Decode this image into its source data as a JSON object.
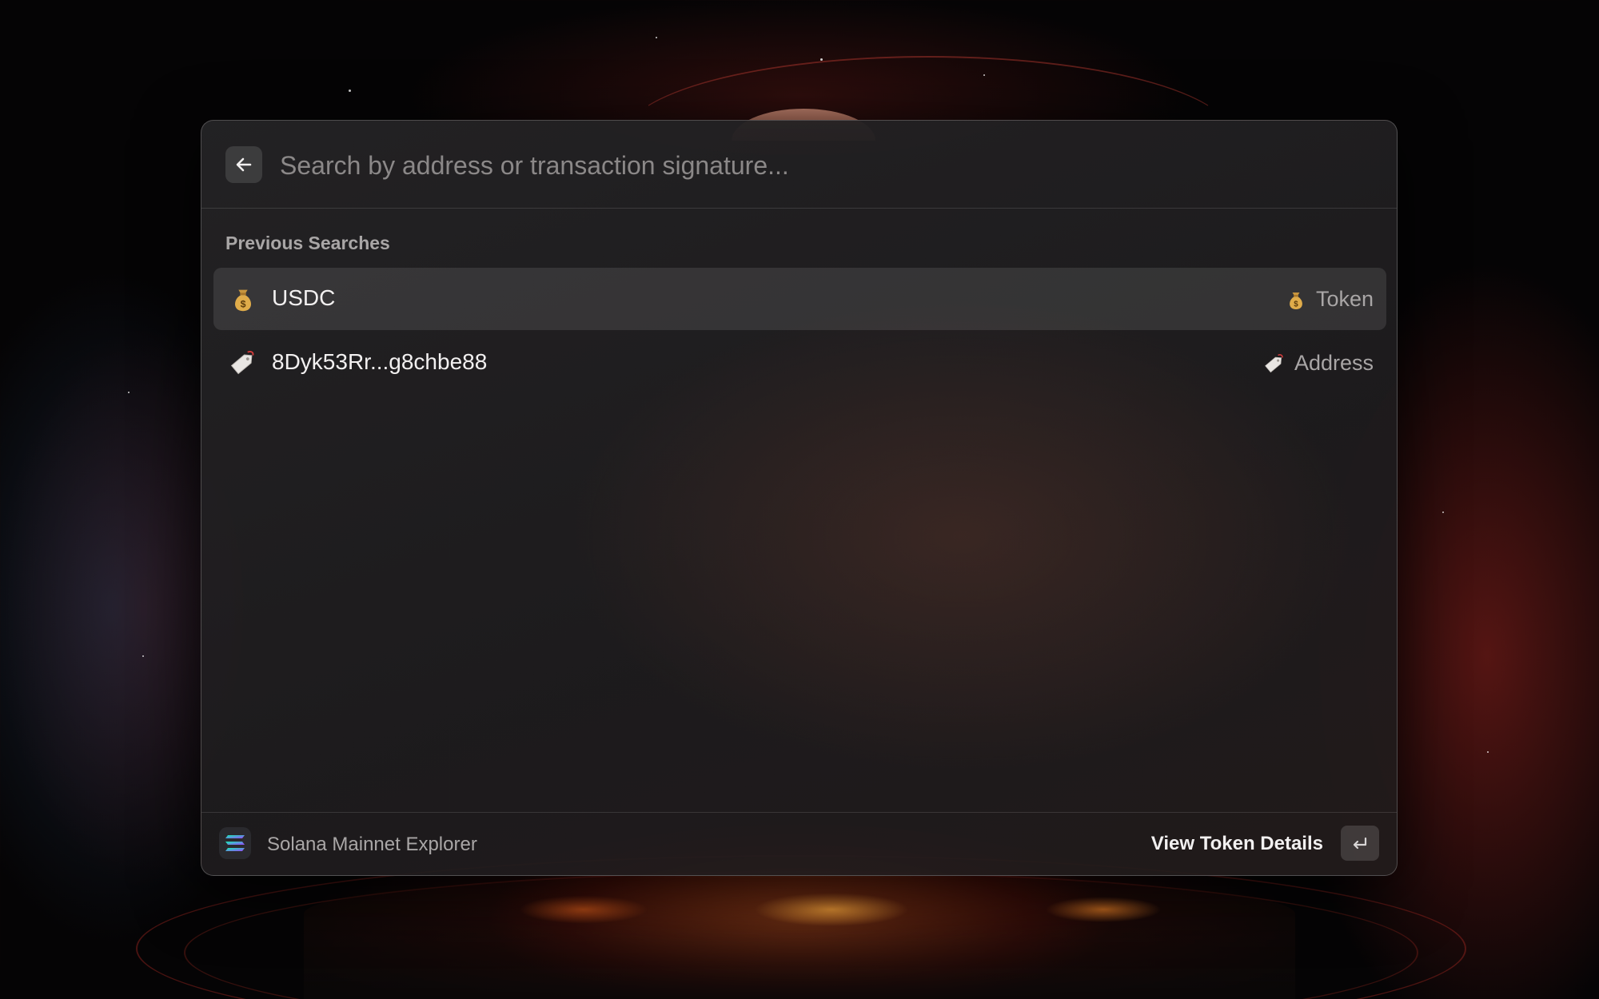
{
  "search": {
    "placeholder": "Search by address or transaction signature..."
  },
  "section": {
    "title": "Previous Searches"
  },
  "results": [
    {
      "label": "USDC",
      "type": "Token",
      "icon": "money-bag-icon",
      "selected": true
    },
    {
      "label": "8Dyk53Rr...g8chbe88",
      "type": "Address",
      "icon": "label-tag-icon",
      "selected": false
    }
  ],
  "footer": {
    "app_name": "Solana Mainnet Explorer",
    "action_label": "View Token Details",
    "shortcut_icon": "return-key-icon"
  },
  "colors": {
    "accent_text": "#f2f0f0",
    "muted_text": "#a9a6a6",
    "selected_row": "rgba(255,255,255,0.10)"
  }
}
